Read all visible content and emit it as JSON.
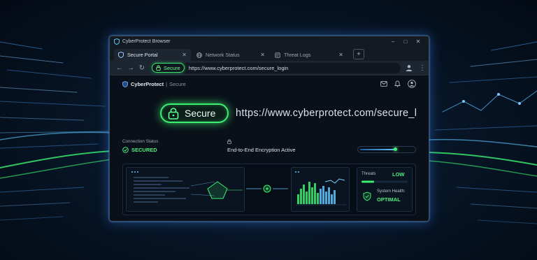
{
  "window": {
    "title": "CyberProtect Browser",
    "controls": {
      "minimize": "–",
      "maximize": "□",
      "close": "✕"
    }
  },
  "tabs": [
    {
      "label": "Secure Portal",
      "icon": "shield-icon",
      "active": true
    },
    {
      "label": "Network Status",
      "icon": "globe-icon",
      "active": false
    },
    {
      "label": "Threat Logs",
      "icon": "document-icon",
      "active": false
    }
  ],
  "new_tab": "+",
  "addressbar": {
    "back": "←",
    "forward": "→",
    "reload": "↻",
    "secure_label": "Secure",
    "url": "https://www.cyberprotect.com/secure_login"
  },
  "app": {
    "brand": "CyberProtect",
    "section": "Secure"
  },
  "hero": {
    "secure_label": "Secure",
    "url": "https://www.cyberprotect.com/secure_l"
  },
  "status": {
    "connection_label": "Connection Status",
    "connection_value": "SECURED",
    "encryption_label": "End-to-End Encryption Active",
    "encryption_level": 0.68
  },
  "stats": {
    "threats_label": "Threats",
    "threats_value": "LOW",
    "health_label": "System Health:",
    "health_value": "OPTIMAL"
  },
  "colors": {
    "accent_green": "#3cf070",
    "glow_blue": "#3c8cff",
    "bg_dark": "#071628"
  }
}
